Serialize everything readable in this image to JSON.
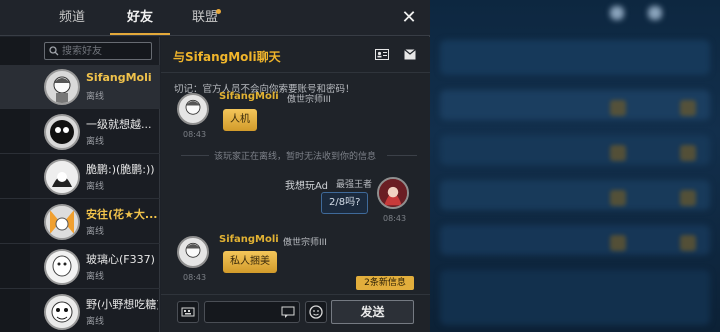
{
  "tabs": [
    {
      "label": "频道",
      "active": false
    },
    {
      "label": "好友",
      "active": true
    },
    {
      "label": "联盟",
      "active": false,
      "dot": true
    }
  ],
  "colors": {
    "accent": "#e4a93a",
    "name_gold": "#f0b52b",
    "panel": "#1d2128"
  },
  "search": {
    "placeholder": "搜索好友"
  },
  "friends": [
    {
      "name": "SifangMoli",
      "status": "离线",
      "highlight": true,
      "selected": true
    },
    {
      "name": "一级就想越...",
      "status": "离线"
    },
    {
      "name": "脆鹏:)(脆鹏:))",
      "status": "离线"
    },
    {
      "name": "安往(花★大...",
      "status": "离线",
      "highlight": true
    },
    {
      "name": "玻璃心(F337)",
      "status": "离线"
    },
    {
      "name": "野(小野想吃糖)",
      "status": "离线"
    }
  ],
  "chat": {
    "title": "与SifangMoli聊天",
    "warning": "切记：官方人员不会向你索要账号和密码！",
    "system_notice": "该玩家正在离线，暂时无法收到你的信息",
    "messages": [
      {
        "sender": "SifangMoli",
        "rank": "傲世宗师III",
        "time": "08:43",
        "text": "人机",
        "side": "left"
      },
      {
        "sender": "我想玩Ad",
        "rank": "最强王者",
        "time": "08:43",
        "text": "2/8吗?",
        "side": "right"
      },
      {
        "sender": "SifangMoli",
        "rank": "傲世宗师III",
        "time": "08:43",
        "text": "私人捆美",
        "side": "left"
      }
    ],
    "new_messages": "2条新信息",
    "send_label": "发送"
  },
  "icons": {
    "close": "close-icon",
    "profile": "id-card-icon",
    "mail": "envelope-icon",
    "keyboard": "keyboard-icon",
    "emoji": "emoji-icon",
    "quick_reply": "quick-reply-icon"
  }
}
